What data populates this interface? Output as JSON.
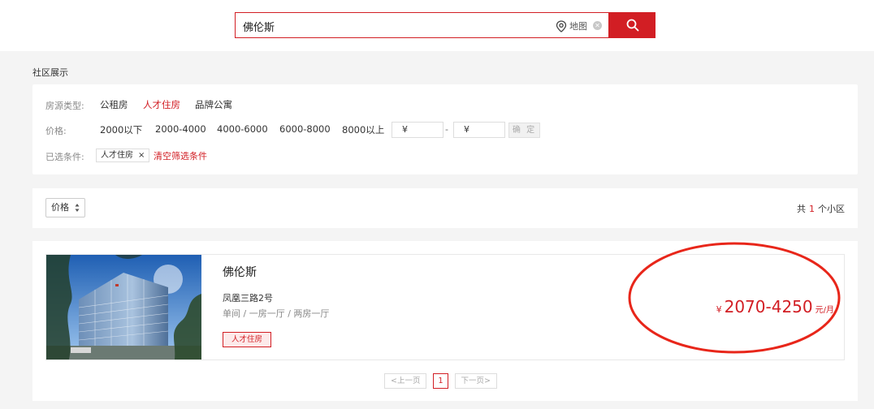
{
  "search": {
    "value": "佛伦斯",
    "map_label": "地图",
    "clear_icon": "clear-circle-icon",
    "button_icon": "search-icon"
  },
  "section_title": "社区展示",
  "filters": {
    "house_type": {
      "label": "房源类型:",
      "options": [
        "公租房",
        "人才住房",
        "品牌公寓"
      ],
      "active": "人才住房"
    },
    "price": {
      "label": "价格:",
      "options": [
        "2000以下",
        "2000-4000",
        "4000-6000",
        "6000-8000",
        "8000以上"
      ],
      "min_placeholder": "¥",
      "max_placeholder": "¥",
      "separator": "-",
      "confirm_label": "确 定"
    },
    "selected": {
      "label": "已选条件:",
      "chips": [
        "人才住房"
      ],
      "chip_close": "×",
      "clear_all": "清空筛选条件"
    }
  },
  "sort": {
    "label": "价格",
    "count_prefix": "共",
    "count": "1",
    "count_suffix": "个小区"
  },
  "listings": [
    {
      "title": "佛伦斯",
      "address": "凤凰三路2号",
      "rooms": "单间 / 一房一厅 / 两房一厅",
      "tag": "人才住房",
      "price_currency": "¥",
      "price_range": "2070-4250",
      "price_unit": "元/月"
    }
  ],
  "pagination": {
    "prev": "<上一页",
    "current": "1",
    "next": "下一页>"
  },
  "colors": {
    "accent": "#d21e24",
    "annotation": "#e8261a"
  }
}
